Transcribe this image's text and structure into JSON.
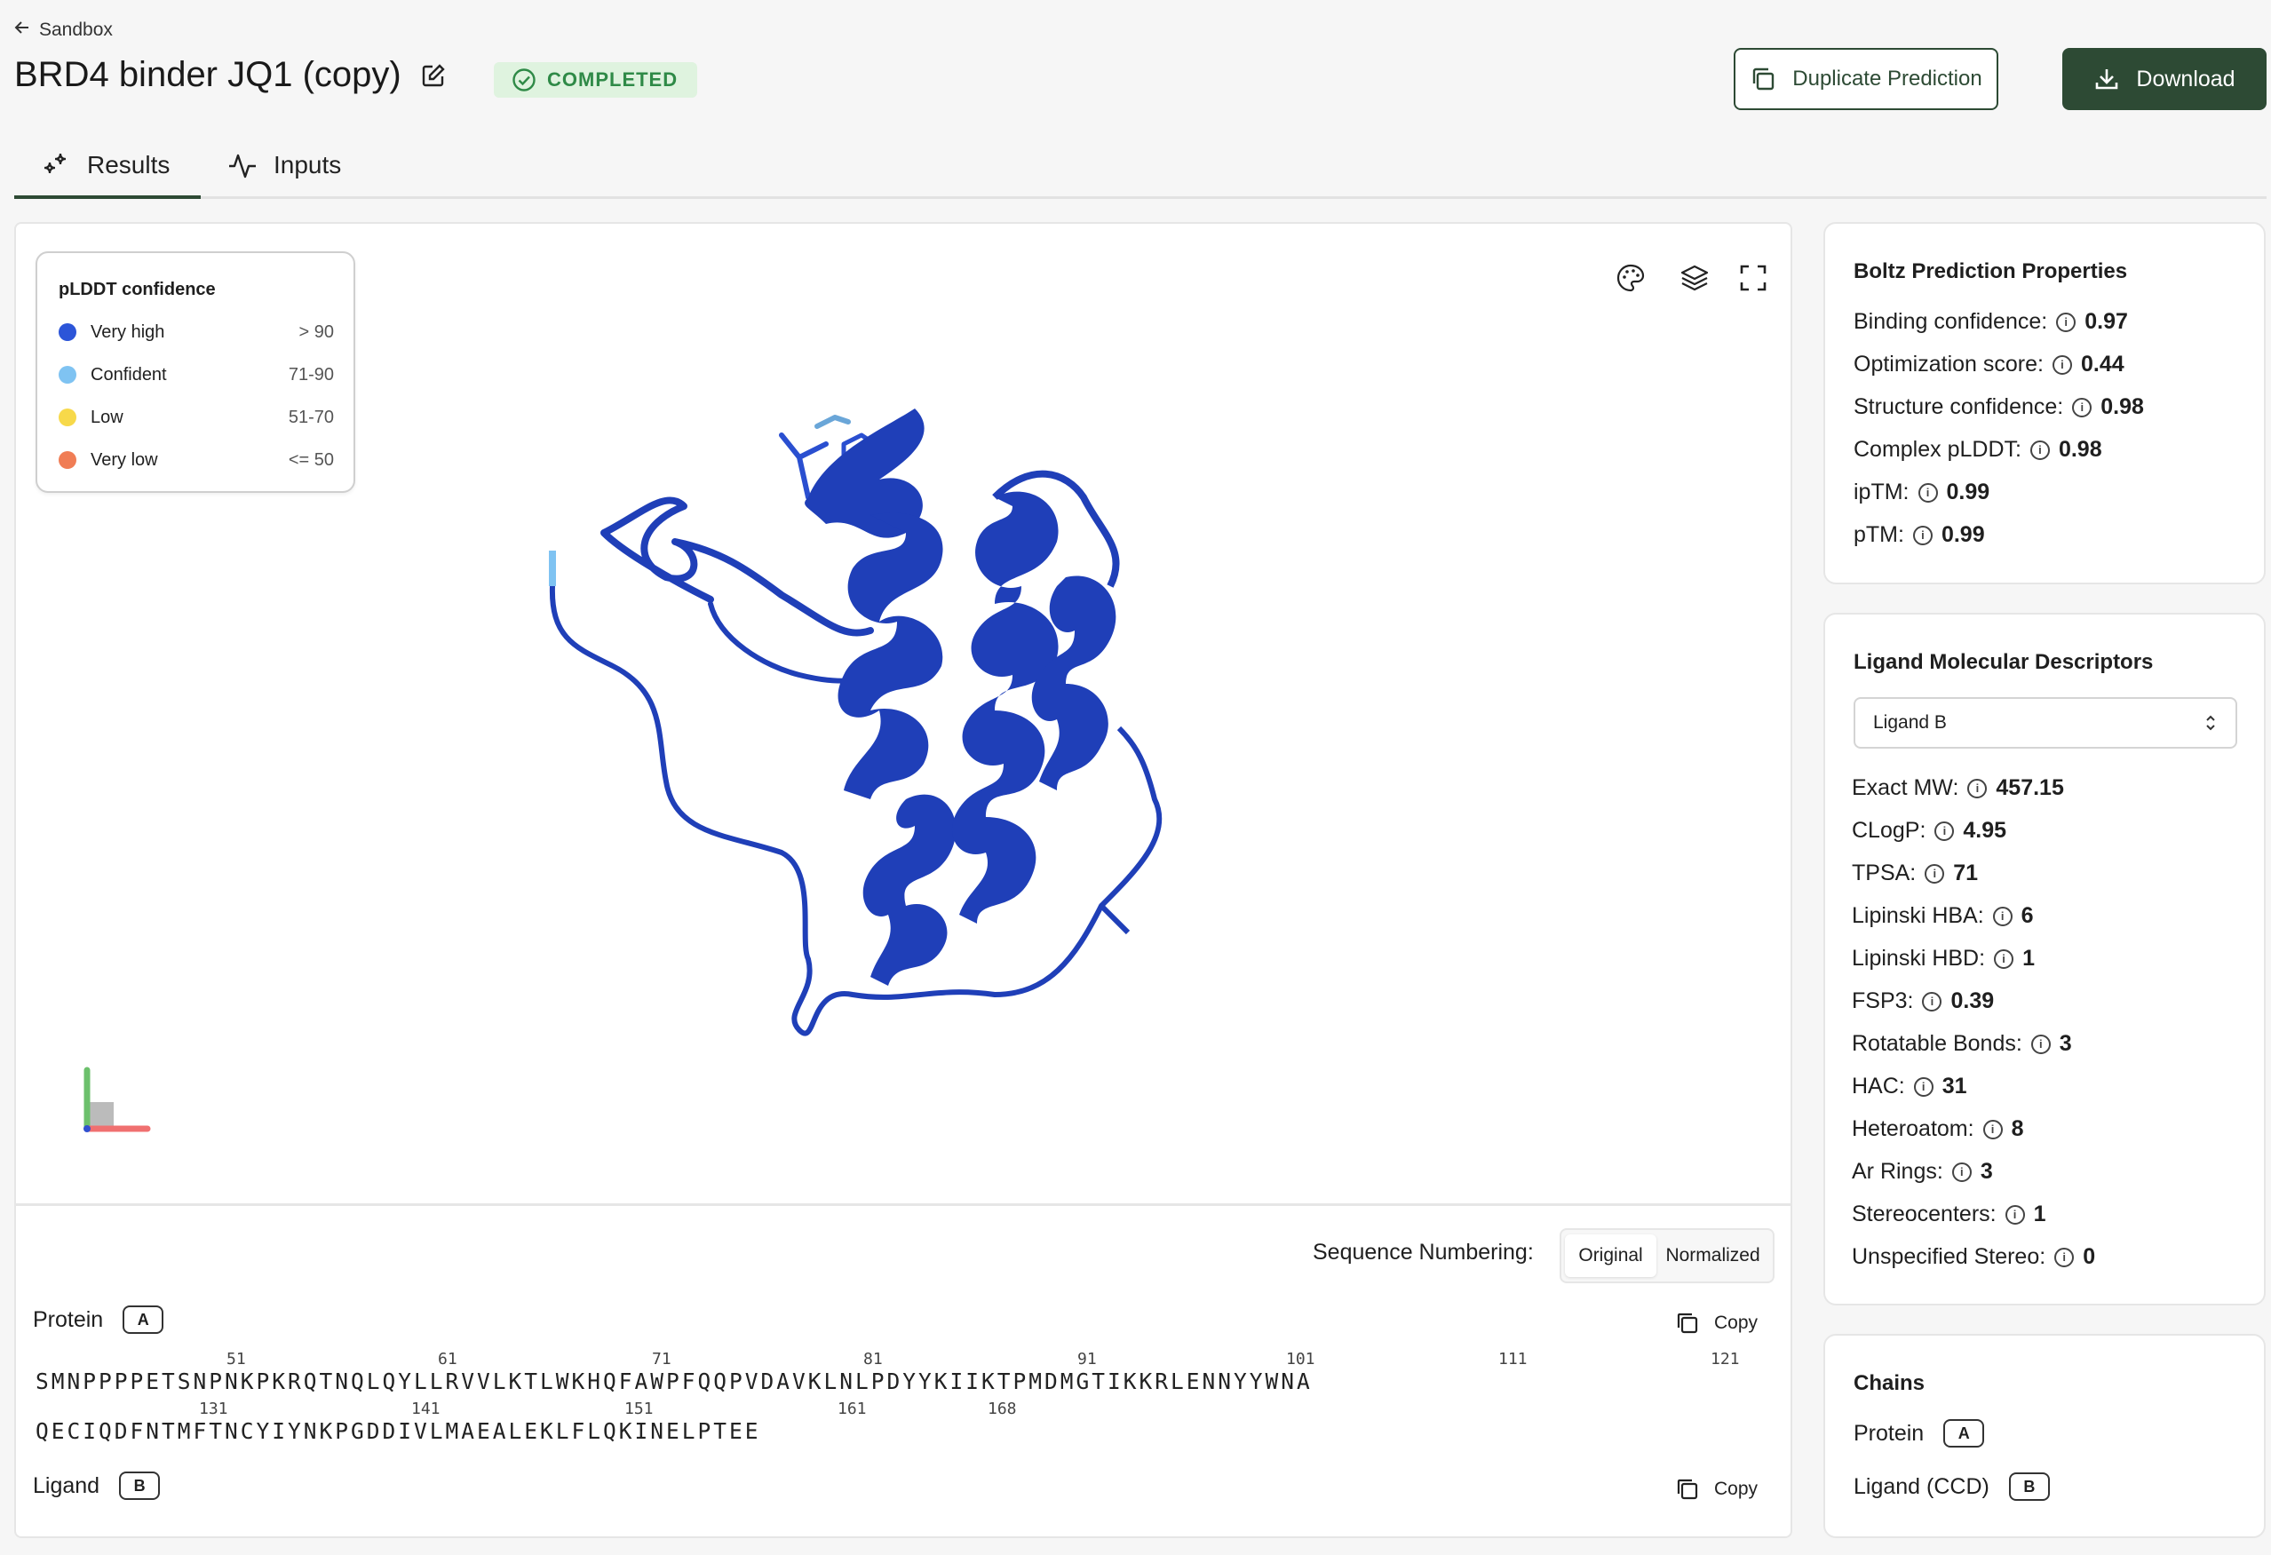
{
  "header": {
    "back_label": "Sandbox",
    "title": "BRD4 binder JQ1 (copy)",
    "status": "COMPLETED",
    "duplicate_label": "Duplicate Prediction",
    "download_label": "Download"
  },
  "tabs": [
    {
      "label": "Results",
      "active": true
    },
    {
      "label": "Inputs",
      "active": false
    }
  ],
  "legend": {
    "title": "pLDDT confidence",
    "items": [
      {
        "label": "Very high",
        "range": "> 90",
        "color": "#2c55d8"
      },
      {
        "label": "Confident",
        "range": "71-90",
        "color": "#7fc3f2"
      },
      {
        "label": "Low",
        "range": "51-70",
        "color": "#f7d94a"
      },
      {
        "label": "Very low",
        "range": "<= 50",
        "color": "#f07d55"
      }
    ]
  },
  "viewer_tools": [
    "palette-icon",
    "layers-icon",
    "fullscreen-icon"
  ],
  "sequence": {
    "numbering_label": "Sequence Numbering:",
    "options": [
      "Original",
      "Normalized"
    ],
    "selected": "Original",
    "copy_label": "Copy",
    "protein": {
      "label": "Protein",
      "chain": "A",
      "line1": "SMNPPPPETSNPNKPKRQTNQLQYLLRVVLKTLWKHQFAWPFQQPVDAVKLNLPDYYKIIKTPMDMGTIKKRLENNYYWNA",
      "line2": "QECIQDFNTMFTNCYIYNKPGDDIVLMAEALEKLFLQKINELPTEE",
      "markers1": [
        "51",
        "61",
        "71",
        "81",
        "91",
        "101",
        "111",
        "121"
      ],
      "markers2": [
        "131",
        "141",
        "151",
        "161",
        "168"
      ]
    },
    "ligand": {
      "label": "Ligand",
      "chain": "B"
    }
  },
  "boltz": {
    "title": "Boltz Prediction Properties",
    "props": [
      {
        "label": "Binding confidence:",
        "value": "0.97"
      },
      {
        "label": "Optimization score:",
        "value": "0.44"
      },
      {
        "label": "Structure confidence:",
        "value": "0.98"
      },
      {
        "label": "Complex pLDDT:",
        "value": "0.98"
      },
      {
        "label": "ipTM:",
        "value": "0.99"
      },
      {
        "label": "pTM:",
        "value": "0.99"
      }
    ]
  },
  "ligand_desc": {
    "title": "Ligand Molecular Descriptors",
    "selected_ligand": "Ligand B",
    "props": [
      {
        "label": "Exact MW:",
        "value": "457.15"
      },
      {
        "label": "CLogP:",
        "value": "4.95"
      },
      {
        "label": "TPSA:",
        "value": "71"
      },
      {
        "label": "Lipinski HBA:",
        "value": "6"
      },
      {
        "label": "Lipinski HBD:",
        "value": "1"
      },
      {
        "label": "FSP3:",
        "value": "0.39"
      },
      {
        "label": "Rotatable Bonds:",
        "value": "3"
      },
      {
        "label": "HAC:",
        "value": "31"
      },
      {
        "label": "Heteroatom:",
        "value": "8"
      },
      {
        "label": "Ar Rings:",
        "value": "3"
      },
      {
        "label": "Stereocenters:",
        "value": "1"
      },
      {
        "label": "Unspecified Stereo:",
        "value": "0"
      }
    ]
  },
  "chains": {
    "title": "Chains",
    "items": [
      {
        "label": "Protein",
        "chain": "A"
      },
      {
        "label": "Ligand (CCD)",
        "chain": "B"
      }
    ]
  },
  "colors": {
    "accent": "#2d4a34",
    "status_bg": "#dff3df",
    "status_text": "#2f8a47",
    "protein": "#1f3fb8"
  }
}
